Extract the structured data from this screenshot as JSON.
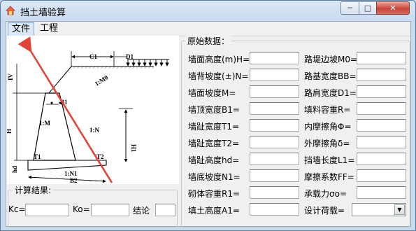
{
  "window": {
    "title": "挡土墙验算",
    "min_glyph": "─",
    "max_glyph": "□",
    "close_glyph": "✕"
  },
  "menu": {
    "file": "文件",
    "project": "工程"
  },
  "diagram": {
    "c1": "C1",
    "d1": "D1",
    "slope_m0": "1:M0",
    "b1": "B1",
    "iv": "IV",
    "h": "H",
    "m": "1:M",
    "n": "1:N",
    "t1": "T1",
    "t2": "T2",
    "n1": "1:N1",
    "b2": "B2",
    "h1": "H1",
    "hd": "hd"
  },
  "raw_data": {
    "title": "原始数据：",
    "left": [
      {
        "label": "墙面高度(m)H=",
        "value": ""
      },
      {
        "label": "墙背坡度(±)N=",
        "value": ""
      },
      {
        "label": "墙面坡度M=",
        "value": ""
      },
      {
        "label": "墙顶宽度B1=",
        "value": ""
      },
      {
        "label": "墙趾宽度T1=",
        "value": ""
      },
      {
        "label": "墙趾宽度T2=",
        "value": ""
      },
      {
        "label": "墙趾高度hd=",
        "value": ""
      },
      {
        "label": "墙底坡度N1=",
        "value": ""
      },
      {
        "label": "砌体容重R1=",
        "value": ""
      },
      {
        "label": "填土高度A1=",
        "value": ""
      }
    ],
    "right": [
      {
        "label": "路堤边坡M0=",
        "value": ""
      },
      {
        "label": "路基宽度BB=",
        "value": ""
      },
      {
        "label": "路肩宽度D1=",
        "value": ""
      },
      {
        "label": "填料容重R=",
        "value": ""
      },
      {
        "label": "内摩擦角Φ=",
        "value": ""
      },
      {
        "label": "外摩擦角δ=",
        "value": ""
      },
      {
        "label": "挡墙长度L1=",
        "value": ""
      },
      {
        "label": "摩擦系数FF=",
        "value": ""
      },
      {
        "label": "承载力σo=",
        "value": ""
      }
    ],
    "design_load_label": "设计荷载=",
    "design_load_value": ""
  },
  "results": {
    "title": "计算结果:",
    "kc_label": "Kc=",
    "kc_value": "",
    "ko_label": "Ko=",
    "ko_value": "",
    "conclusion_label": "结论",
    "conclusion_value": ""
  },
  "colors": {
    "annotation_arrow": "#e0443b"
  }
}
